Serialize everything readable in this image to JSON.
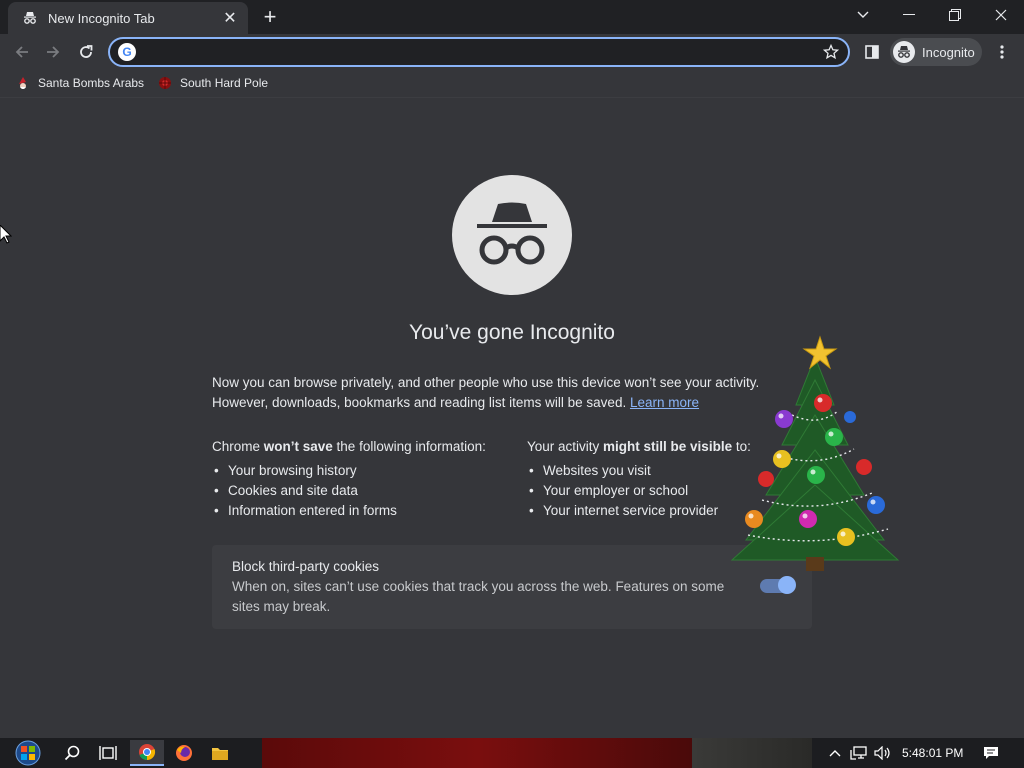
{
  "browser": {
    "tab_title": "New Incognito Tab",
    "new_tab_symbol": "+",
    "window_controls": [
      "chevron-down-icon",
      "minimize-icon",
      "restore-icon",
      "close-icon"
    ]
  },
  "toolbar": {
    "omnibox_value": "",
    "profile_label": "Incognito"
  },
  "bookmarks": [
    {
      "label": "Santa Bombs Arabs",
      "icon": "santa-icon"
    },
    {
      "label": "South Hard Pole",
      "icon": "red-orb-icon"
    }
  ],
  "page": {
    "headline": "You’ve gone Incognito",
    "intro_line1": "Now you can browse privately, and other people who use this device won’t see your activity.",
    "intro_line2": "However, downloads, bookmarks and reading list items will be saved.",
    "learn_more": "Learn more",
    "left_col": {
      "head_pre": "Chrome ",
      "head_bold": "won’t save",
      "head_post": " the following information:",
      "items": [
        "Your browsing history",
        "Cookies and site data",
        "Information entered in forms"
      ]
    },
    "right_col": {
      "head_pre": "Your activity ",
      "head_bold": "might still be visible",
      "head_post": " to:",
      "items": [
        "Websites you visit",
        "Your employer or school",
        "Your internet service provider"
      ]
    },
    "cookies": {
      "title": "Block third-party cookies",
      "description": "When on, sites can’t use cookies that track you across the web. Features on some sites may break.",
      "enabled": true
    }
  },
  "taskbar": {
    "time": "5:48:01 PM",
    "pinned": [
      "start-orb-icon",
      "search-icon",
      "task-view-icon",
      "chrome-icon",
      "firefox-icon",
      "file-explorer-icon"
    ]
  },
  "colors": {
    "background": "#35363a",
    "titlebar": "#202124",
    "accent": "#8ab4f8"
  }
}
